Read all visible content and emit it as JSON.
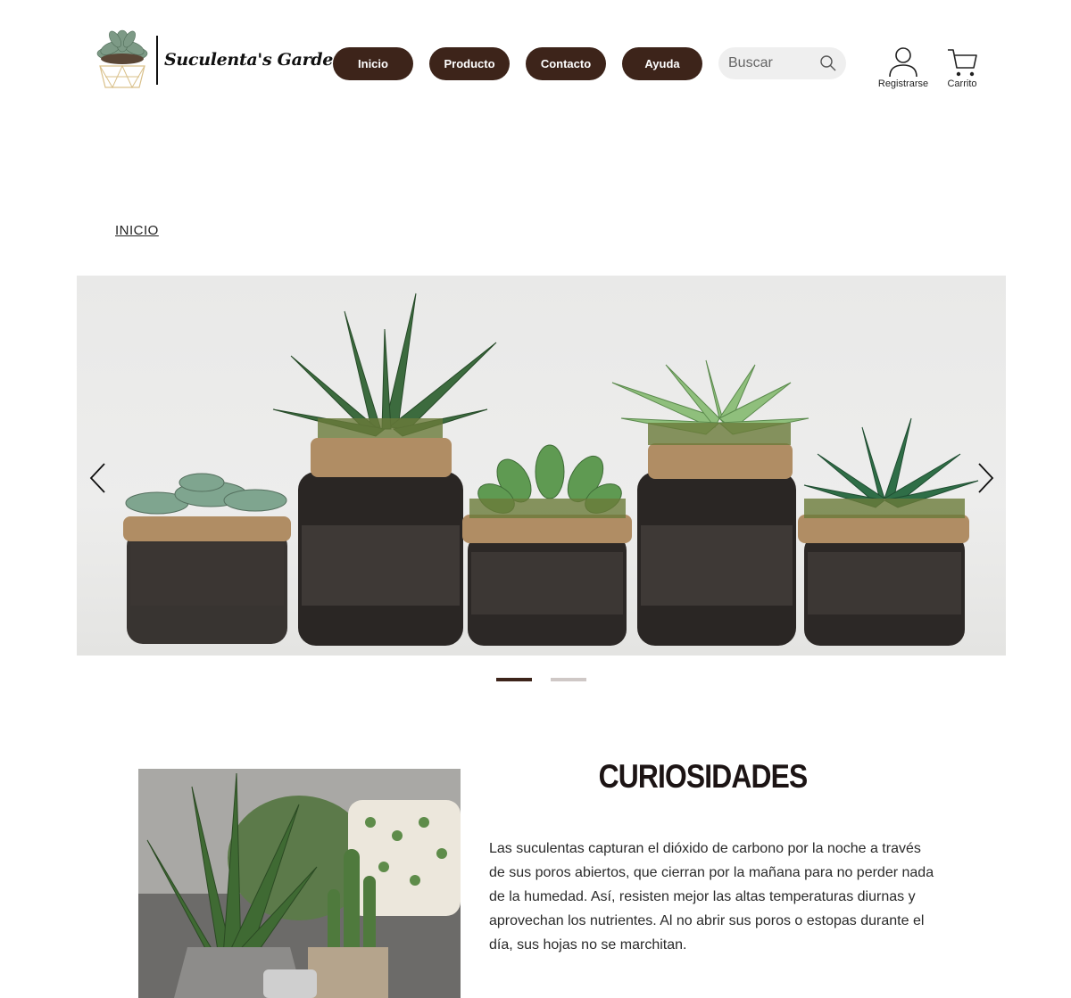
{
  "brand": {
    "name": "Suculenta's Garden"
  },
  "nav": {
    "items": [
      {
        "label": "Inicio"
      },
      {
        "label": "Producto"
      },
      {
        "label": "Contacto"
      },
      {
        "label": "Ayuda"
      }
    ]
  },
  "search": {
    "placeholder": "Buscar",
    "icon": "search-icon"
  },
  "account": {
    "register_label": "Registrarse",
    "cart_label": "Carrito"
  },
  "breadcrumb": {
    "label": "INICIO"
  },
  "carousel": {
    "slides_total": 2,
    "active_slide": 1
  },
  "curiosidades": {
    "title": "CURIOSIDADES",
    "body": "Las suculentas capturan el dióxido de carbono por la noche a través de sus poros abiertos, que cierran por la mañana para no perder nada de la humedad. Así, resisten mejor las altas temperaturas diurnas y aprovechan los nutrientes. Al no abrir sus poros o estopas durante el día, sus hojas no se marchitan."
  },
  "colors": {
    "accent": "#3d241a",
    "dot_inactive": "#cfc8c6",
    "search_bg": "#efefef"
  }
}
